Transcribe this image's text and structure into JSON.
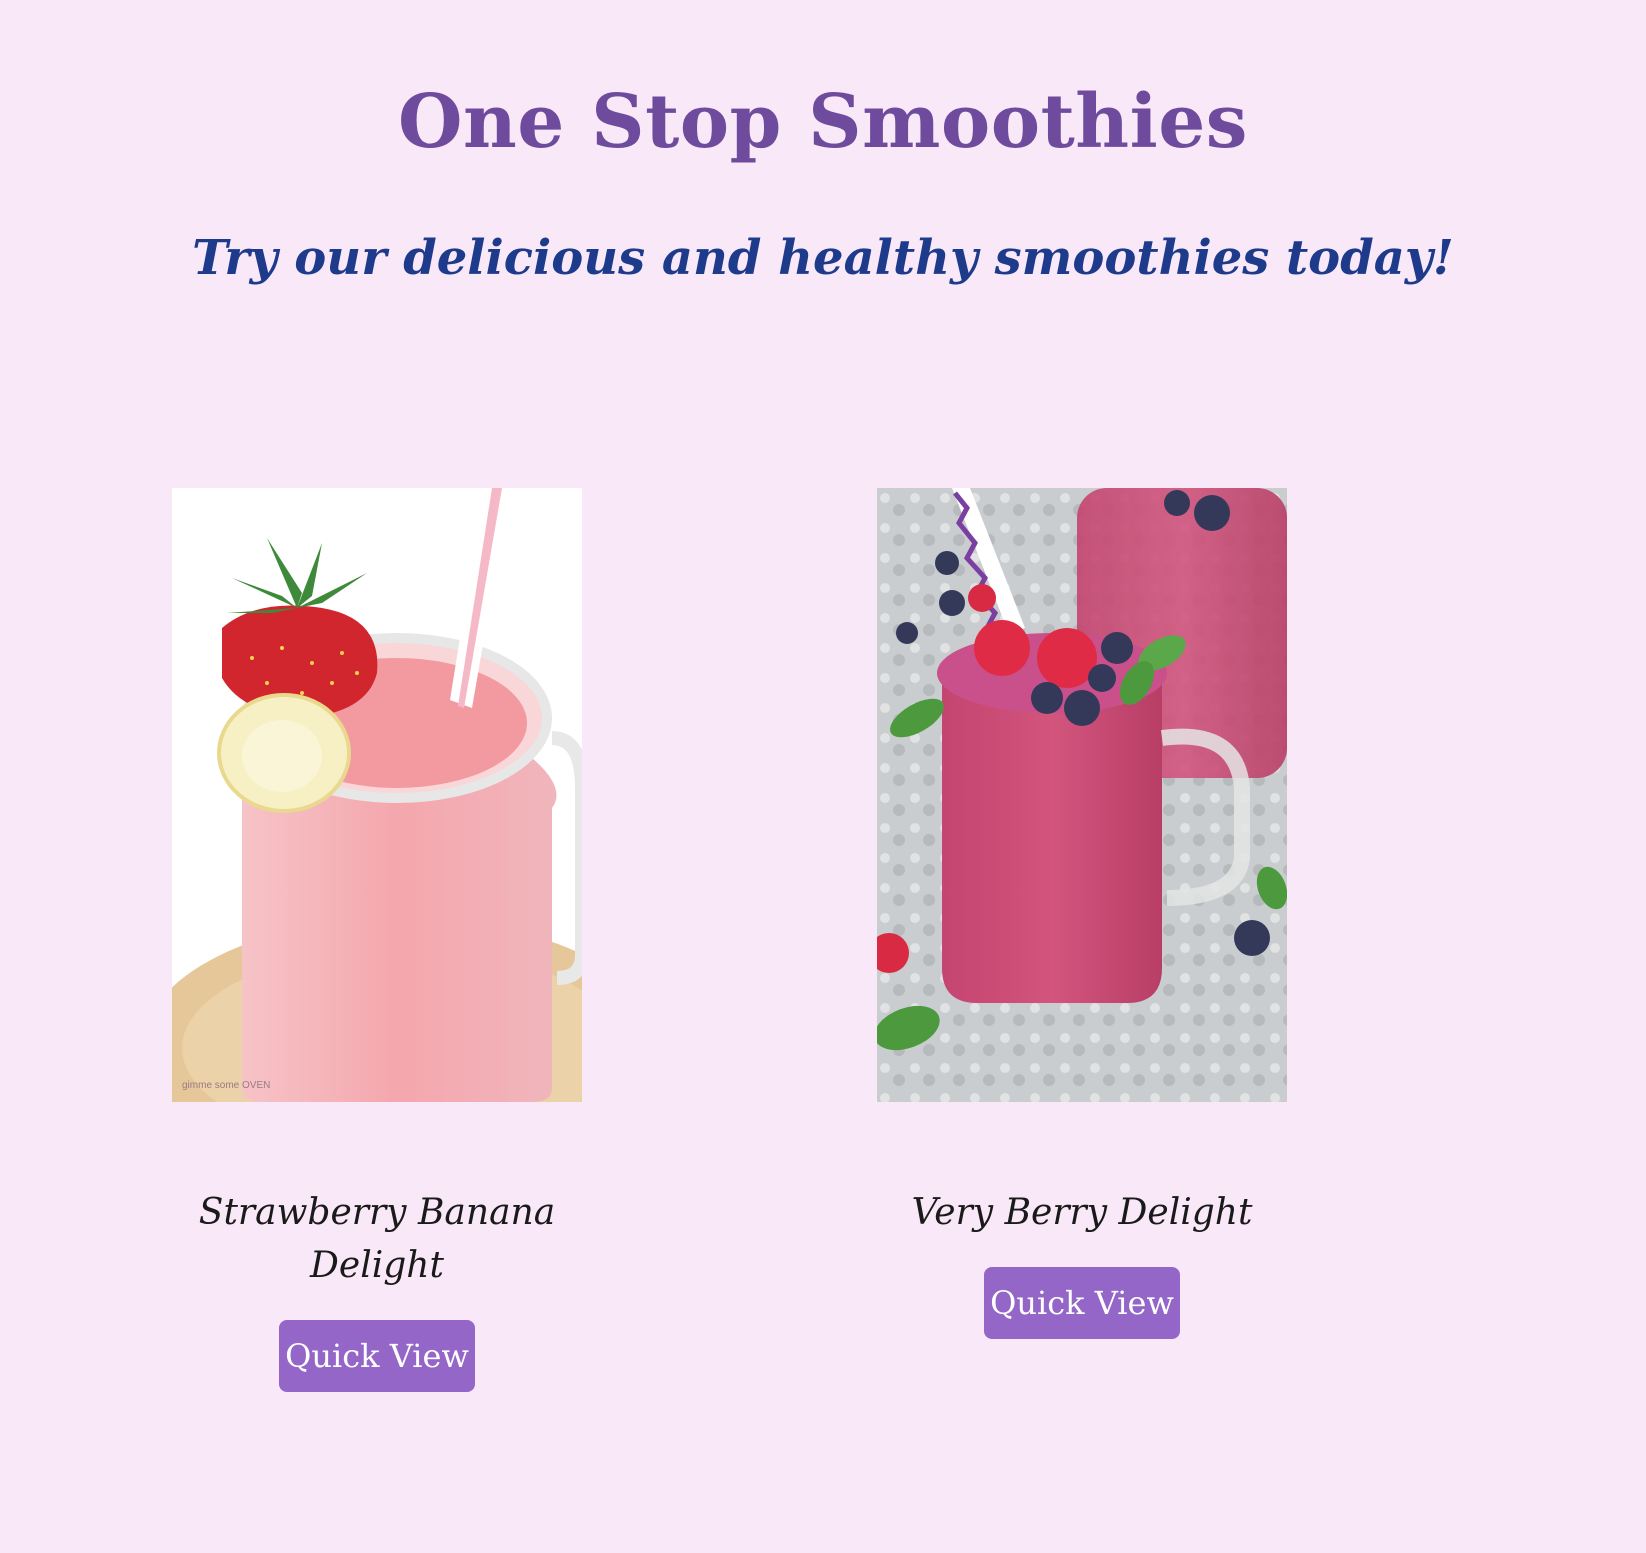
{
  "header": {
    "title": "One Stop Smoothies",
    "tagline": "Try our delicious and healthy smoothies today!"
  },
  "products": [
    {
      "name": "Strawberry Banana Delight",
      "button_label": "Quick View",
      "image_icon": "strawberry-banana-smoothie-image",
      "watermark": "gimme some OVEN"
    },
    {
      "name": "Very Berry Delight",
      "button_label": "Quick View",
      "image_icon": "very-berry-smoothie-image"
    }
  ],
  "colors": {
    "background": "#f8e8f8",
    "title": "#6f4b9e",
    "tagline": "#1e3a8a",
    "button": "#9366c8"
  }
}
